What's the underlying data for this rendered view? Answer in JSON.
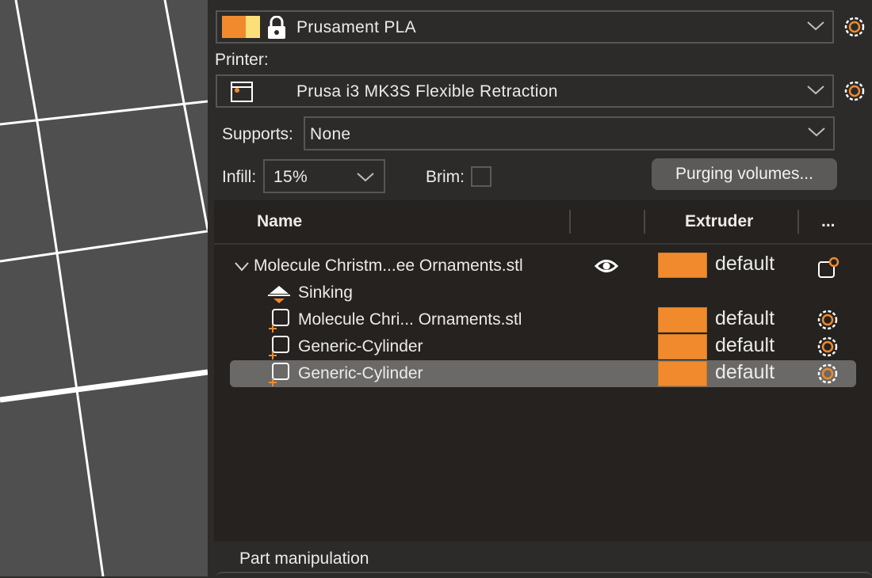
{
  "filament": {
    "name": "Prusament PLA",
    "colors": [
      "#f08a2c",
      "#fbe07a"
    ]
  },
  "printer": {
    "label": "Printer:",
    "name": "Prusa i3 MK3S Flexible Retraction"
  },
  "supports": {
    "label": "Supports:",
    "value": "None"
  },
  "infill": {
    "label": "Infill:",
    "value": "15%"
  },
  "brim": {
    "label": "Brim:",
    "checked": false
  },
  "purging_button": "Purging volumes...",
  "object_list": {
    "columns": {
      "name": "Name",
      "visibility": "",
      "extruder": "Extruder",
      "more": "..."
    },
    "object": {
      "name": "Molecule Christm...ee Ornaments.stl",
      "extruder": "default",
      "extruder_color": "#f08a2c",
      "icon": "eye-icon"
    },
    "sinking_label": "Sinking",
    "parts": [
      {
        "name": "Molecule Chri... Ornaments.stl",
        "extruder": "default",
        "selected": false
      },
      {
        "name": "Generic-Cylinder",
        "extruder": "default",
        "selected": false
      },
      {
        "name": "Generic-Cylinder",
        "extruder": "default",
        "selected": true
      }
    ]
  },
  "part_manipulation": "Part manipulation",
  "accent_color": "#f08a2c"
}
